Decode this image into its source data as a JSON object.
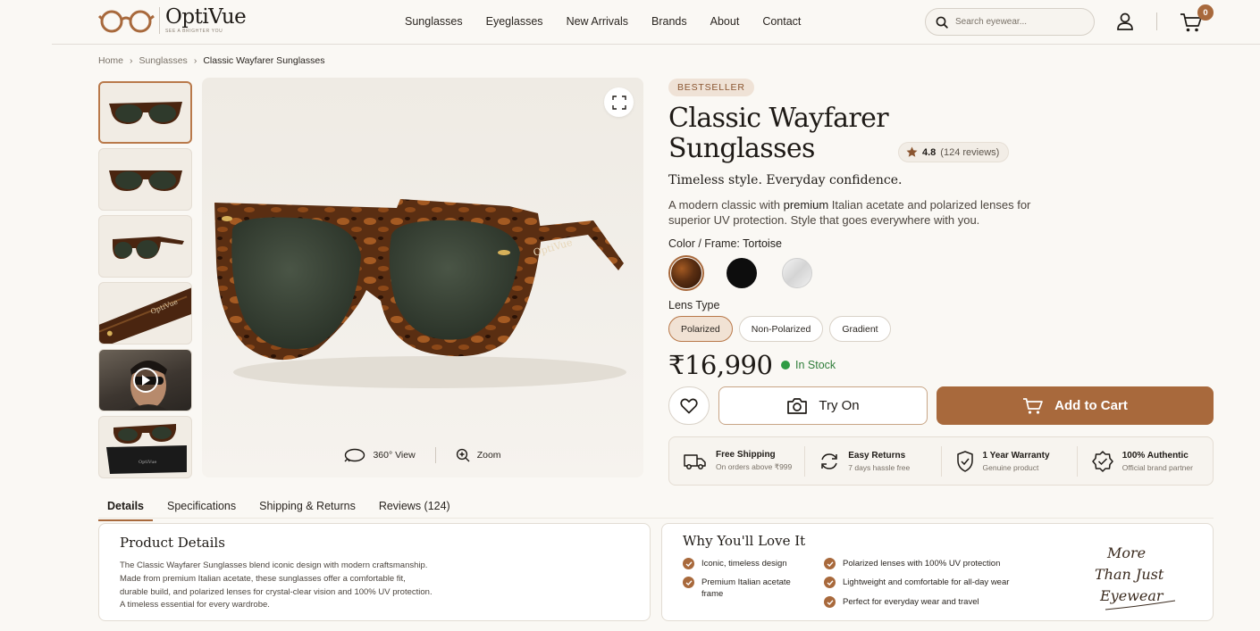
{
  "brand": {
    "name": "OptiVue",
    "tagline": "SEE A BRIGHTER YOU"
  },
  "nav": [
    "Sunglasses",
    "Eyeglasses",
    "New Arrivals",
    "Brands",
    "About",
    "Contact"
  ],
  "search": {
    "placeholder": "Search eyewear..."
  },
  "cart": {
    "count": "0"
  },
  "breadcrumb": [
    "Home",
    "Sunglasses",
    "Classic Wayfarer Sunglasses"
  ],
  "gallery": {
    "view360": "360° View",
    "zoom": "Zoom"
  },
  "product": {
    "badge": "BESTSELLER",
    "title": "Classic Wayfarer Sunglasses",
    "rating": "4.8",
    "reviews": "(124 reviews)",
    "tagline": "Timeless style. Everyday confidence.",
    "desc_pre": "A modern classic with ",
    "desc_bold": "premium",
    "desc_post": " Italian acetate and polarized lenses for superior UV protection. Style that goes everywhere with you.",
    "color_label": "Color / Frame: ",
    "color_value": "Tortoise",
    "lens_label": "Lens Type",
    "lens_options": [
      "Polarized",
      "Non-Polarized",
      "Gradient"
    ],
    "price": "₹16,990",
    "stock": "In Stock",
    "try_on": "Try On",
    "add_to_cart": "Add to Cart"
  },
  "colors": {
    "accent": "#a8693c",
    "stock": "#2f9c44",
    "tortoise": "#5a2e12",
    "black": "#0d0d0d",
    "clear": "#e8e8e8"
  },
  "features": [
    {
      "title": "Free Shipping",
      "sub": "On orders above ₹999",
      "icon": "truck-icon"
    },
    {
      "title": "Easy Returns",
      "sub": "7 days hassle free",
      "icon": "returns-icon"
    },
    {
      "title": "1 Year Warranty",
      "sub": "Genuine product",
      "icon": "shield-check-icon"
    },
    {
      "title": "100% Authentic",
      "sub": "Official brand partner",
      "icon": "badge-check-icon"
    }
  ],
  "tabs": [
    "Details",
    "Specifications",
    "Shipping & Returns",
    "Reviews (124)"
  ],
  "details": {
    "title": "Product Details",
    "lines": [
      "The Classic Wayfarer Sunglasses blend iconic design with modern craftsmanship.",
      "Made from premium Italian acetate, these sunglasses offer a comfortable fit,",
      "durable build, and polarized lenses for crystal-clear vision and 100% UV protection.",
      "A timeless essential for every wardrobe."
    ]
  },
  "love": {
    "title": "Why You'll Love It",
    "col1": [
      "Iconic, timeless design",
      "Premium Italian acetate frame"
    ],
    "col2": [
      "Polarized lenses with 100% UV protection",
      "Lightweight and comfortable for all-day wear",
      "Perfect for everyday wear and travel"
    ],
    "script": [
      "More",
      "Than Just",
      "Eyewear"
    ]
  }
}
